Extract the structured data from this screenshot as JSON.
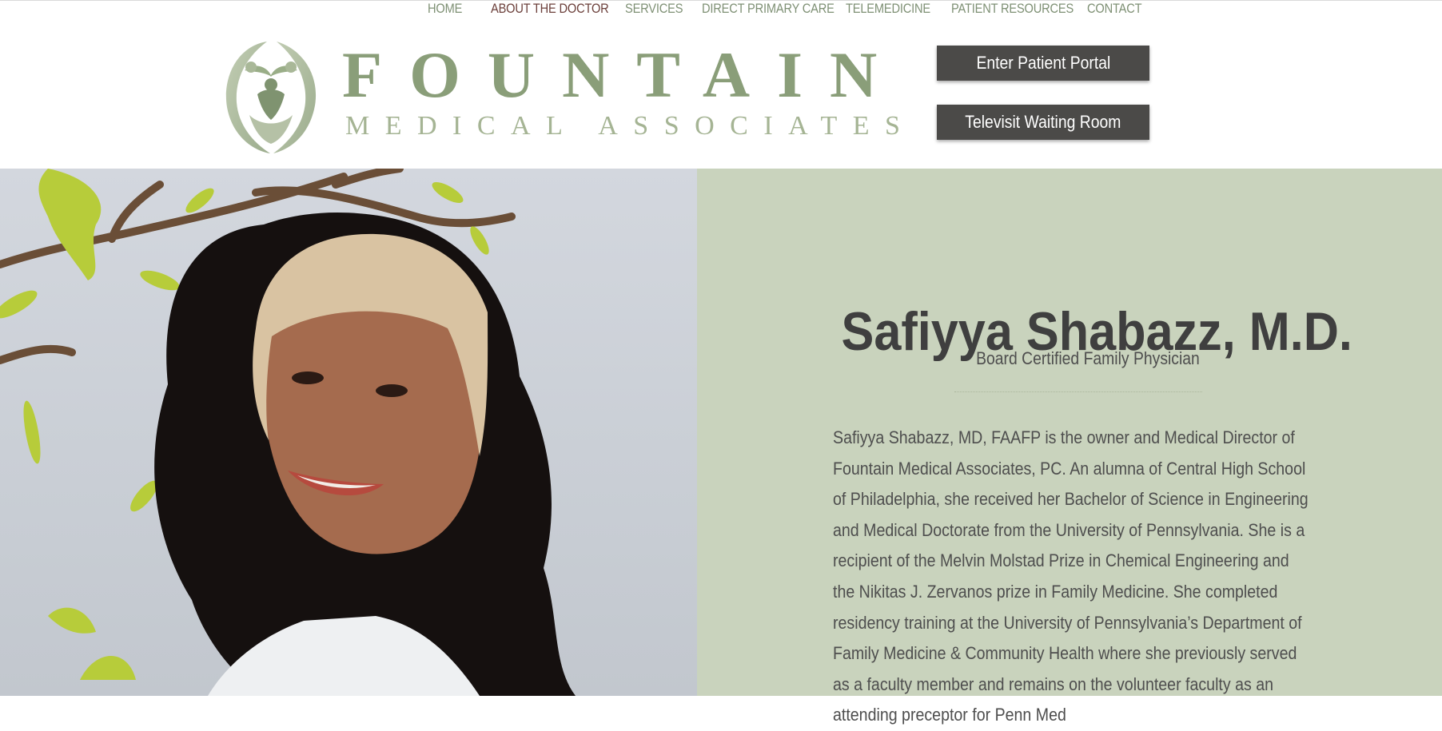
{
  "nav": {
    "items": [
      {
        "label": "HOME"
      },
      {
        "label": "ABOUT THE DOCTOR"
      },
      {
        "label": "SERVICES"
      },
      {
        "label": "DIRECT PRIMARY CARE"
      },
      {
        "label": "TELEMEDICINE"
      },
      {
        "label": "PATIENT RESOURCES"
      },
      {
        "label": "CONTACT"
      }
    ],
    "active": "ABOUT THE DOCTOR"
  },
  "logo": {
    "name": "FOUNTAIN",
    "tagline": "MEDICAL ASSOCIATES",
    "icon": "fountain-figures-logo-icon"
  },
  "buttons": {
    "portal_label": "Enter Patient Portal",
    "televisit_label": "Televisit Waiting Room"
  },
  "doctor": {
    "name": "Safiyya Shabazz, M.D.",
    "title": "Board Certified Family Physician",
    "bio": "Safiyya Shabazz, MD, FAAFP is the owner and Medical Director of Fountain Medical Associates, PC.  An alumna of Central High School of Philadelphia, she received her Bachelor of Science in Engineering and Medical Doctorate from the University of Pennsylvania.  She is a recipient of the Melvin Molstad Prize in Chemical Engineering and the Nikitas J. Zervanos prize in Family Medicine. She completed residency training at the University of Pennsylvania’s Department of Family Medicine & Community Health where she previously served as a faculty member and remains on the volunteer faculty as an attending preceptor for Penn Med",
    "photo": "doctor-portrait-photo"
  },
  "colors": {
    "brand_green": "#8a9e79",
    "nav_text": "#7e9074",
    "nav_active": "#6b3f3a",
    "panel_bg": "#c9d3bd",
    "button_bg": "#4b4a48"
  }
}
